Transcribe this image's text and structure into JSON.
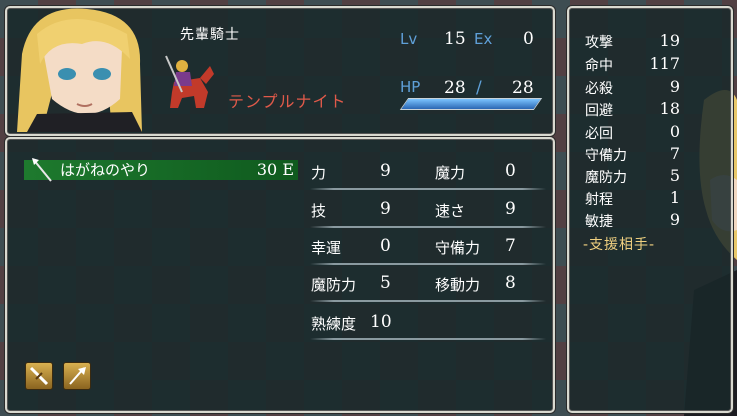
{
  "unit": {
    "class_title": "先輩騎士",
    "job": "テンプルナイト",
    "lv_label": "Lv",
    "lv": "15",
    "ex_label": "Ex",
    "ex": "0",
    "hp_label": "HP",
    "hp_current": "28",
    "hp_sep": "/",
    "hp_max": "28",
    "hp_fill": 1.0
  },
  "weapon": {
    "name": "はがねのやり",
    "uses": "30 E"
  },
  "stats": [
    {
      "label": "力",
      "value": "9"
    },
    {
      "label": "魔力",
      "value": "0"
    },
    {
      "label": "技",
      "value": "9"
    },
    {
      "label": "速さ",
      "value": "9"
    },
    {
      "label": "幸運",
      "value": "0"
    },
    {
      "label": "守備力",
      "value": "7"
    },
    {
      "label": "魔防力",
      "value": "5"
    },
    {
      "label": "移動力",
      "value": "8"
    },
    {
      "label": "熟練度",
      "value": "10"
    }
  ],
  "side_stats": [
    {
      "label": "攻撃",
      "value": "19"
    },
    {
      "label": "命中",
      "value": "117"
    },
    {
      "label": "必殺",
      "value": "9"
    },
    {
      "label": "回避",
      "value": "18"
    },
    {
      "label": "必回",
      "value": "0"
    },
    {
      "label": "守備力",
      "value": "7"
    },
    {
      "label": "魔防力",
      "value": "5"
    },
    {
      "label": "射程",
      "value": "1"
    },
    {
      "label": "敏捷",
      "value": "9"
    }
  ],
  "support_label": "-支援相手-",
  "colors": {
    "job_text": "#e05a4a",
    "label_blue": "#5fa0d8",
    "weapon_bar": "#1e7a2e",
    "hp_bar": "#4a8fe0"
  },
  "icons": [
    "spear-icon",
    "sword-item-icon",
    "spear-item-icon"
  ]
}
